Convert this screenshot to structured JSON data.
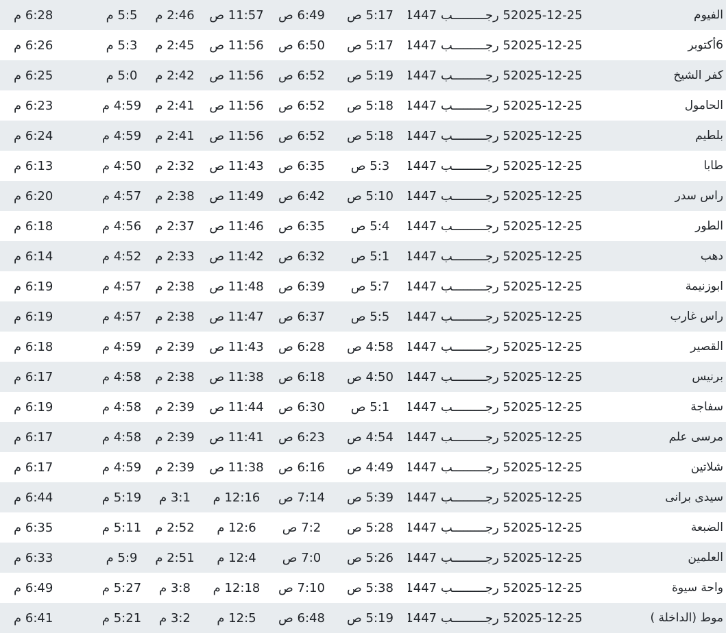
{
  "rows": [
    {
      "city": "الفيوم",
      "date": "2025-12-25",
      "hijri": "5 رجـــــــــب 1447",
      "fajr": "5:17 ص",
      "sunrise": "6:49 ص",
      "dhuhr": "11:57 ص",
      "asr": "2:46 م",
      "maghrib": "5:5 م",
      "isha": "6:28 م"
    },
    {
      "city": "6أكتوبر",
      "date": "2025-12-25",
      "hijri": "5 رجـــــــــب 1447",
      "fajr": "5:17 ص",
      "sunrise": "6:50 ص",
      "dhuhr": "11:56 ص",
      "asr": "2:45 م",
      "maghrib": "5:3 م",
      "isha": "6:26 م"
    },
    {
      "city": "كفر الشيخ",
      "date": "2025-12-25",
      "hijri": "5 رجـــــــــب 1447",
      "fajr": "5:19 ص",
      "sunrise": "6:52 ص",
      "dhuhr": "11:56 ص",
      "asr": "2:42 م",
      "maghrib": "5:0 م",
      "isha": "6:25 م"
    },
    {
      "city": "الحامول",
      "date": "2025-12-25",
      "hijri": "5 رجـــــــــب 1447",
      "fajr": "5:18 ص",
      "sunrise": "6:52 ص",
      "dhuhr": "11:56 ص",
      "asr": "2:41 م",
      "maghrib": "4:59 م",
      "isha": "6:23 م"
    },
    {
      "city": "بلطيم",
      "date": "2025-12-25",
      "hijri": "5 رجـــــــــب 1447",
      "fajr": "5:18 ص",
      "sunrise": "6:52 ص",
      "dhuhr": "11:56 ص",
      "asr": "2:41 م",
      "maghrib": "4:59 م",
      "isha": "6:24 م"
    },
    {
      "city": "طابا",
      "date": "2025-12-25",
      "hijri": "5 رجـــــــــب 1447",
      "fajr": "5:3 ص",
      "sunrise": "6:35 ص",
      "dhuhr": "11:43 ص",
      "asr": "2:32 م",
      "maghrib": "4:50 م",
      "isha": "6:13 م"
    },
    {
      "city": "راس سدر",
      "date": "2025-12-25",
      "hijri": "5 رجـــــــــب 1447",
      "fajr": "5:10 ص",
      "sunrise": "6:42 ص",
      "dhuhr": "11:49 ص",
      "asr": "2:38 م",
      "maghrib": "4:57 م",
      "isha": "6:20 م"
    },
    {
      "city": "الطور",
      "date": "2025-12-25",
      "hijri": "5 رجـــــــــب 1447",
      "fajr": "5:4 ص",
      "sunrise": "6:35 ص",
      "dhuhr": "11:46 ص",
      "asr": "2:37 م",
      "maghrib": "4:56 م",
      "isha": "6:18 م"
    },
    {
      "city": "دهب",
      "date": "2025-12-25",
      "hijri": "5 رجـــــــــب 1447",
      "fajr": "5:1 ص",
      "sunrise": "6:32 ص",
      "dhuhr": "11:42 ص",
      "asr": "2:33 م",
      "maghrib": "4:52 م",
      "isha": "6:14 م"
    },
    {
      "city": "ابوزنيمة",
      "date": "2025-12-25",
      "hijri": "5 رجـــــــــب 1447",
      "fajr": "5:7 ص",
      "sunrise": "6:39 ص",
      "dhuhr": "11:48 ص",
      "asr": "2:38 م",
      "maghrib": "4:57 م",
      "isha": "6:19 م"
    },
    {
      "city": "راس غارب",
      "date": "2025-12-25",
      "hijri": "5 رجـــــــــب 1447",
      "fajr": "5:5 ص",
      "sunrise": "6:37 ص",
      "dhuhr": "11:47 ص",
      "asr": "2:38 م",
      "maghrib": "4:57 م",
      "isha": "6:19 م"
    },
    {
      "city": "القصير",
      "date": "2025-12-25",
      "hijri": "5 رجـــــــــب 1447",
      "fajr": "4:58 ص",
      "sunrise": "6:28 ص",
      "dhuhr": "11:43 ص",
      "asr": "2:39 م",
      "maghrib": "4:59 م",
      "isha": "6:18 م"
    },
    {
      "city": "برنيس",
      "date": "2025-12-25",
      "hijri": "5 رجـــــــــب 1447",
      "fajr": "4:50 ص",
      "sunrise": "6:18 ص",
      "dhuhr": "11:38 ص",
      "asr": "2:38 م",
      "maghrib": "4:58 م",
      "isha": "6:17 م"
    },
    {
      "city": "سفاجة",
      "date": "2025-12-25",
      "hijri": "5 رجـــــــــب 1447",
      "fajr": "5:1 ص",
      "sunrise": "6:30 ص",
      "dhuhr": "11:44 ص",
      "asr": "2:39 م",
      "maghrib": "4:58 م",
      "isha": "6:19 م"
    },
    {
      "city": "مرسى علم",
      "date": "2025-12-25",
      "hijri": "5 رجـــــــــب 1447",
      "fajr": "4:54 ص",
      "sunrise": "6:23 ص",
      "dhuhr": "11:41 ص",
      "asr": "2:39 م",
      "maghrib": "4:58 م",
      "isha": "6:17 م"
    },
    {
      "city": "شلاتين",
      "date": "2025-12-25",
      "hijri": "5 رجـــــــــب 1447",
      "fajr": "4:49 ص",
      "sunrise": "6:16 ص",
      "dhuhr": "11:38 ص",
      "asr": "2:39 م",
      "maghrib": "4:59 م",
      "isha": "6:17 م"
    },
    {
      "city": "سيدى برانى",
      "date": "2025-12-25",
      "hijri": "5 رجـــــــــب 1447",
      "fajr": "5:39 ص",
      "sunrise": "7:14 ص",
      "dhuhr": "12:16 م",
      "asr": "3:1 م",
      "maghrib": "5:19 م",
      "isha": "6:44 م"
    },
    {
      "city": "الضبعة",
      "date": "2025-12-25",
      "hijri": "5 رجـــــــــب 1447",
      "fajr": "5:28 ص",
      "sunrise": "7:2 ص",
      "dhuhr": "12:6 م",
      "asr": "2:52 م",
      "maghrib": "5:11 م",
      "isha": "6:35 م"
    },
    {
      "city": "العلمين",
      "date": "2025-12-25",
      "hijri": "5 رجـــــــــب 1447",
      "fajr": "5:26 ص",
      "sunrise": "7:0 ص",
      "dhuhr": "12:4 م",
      "asr": "2:51 م",
      "maghrib": "5:9 م",
      "isha": "6:33 م"
    },
    {
      "city": "واحة سيوة",
      "date": "2025-12-25",
      "hijri": "5 رجـــــــــب 1447",
      "fajr": "5:38 ص",
      "sunrise": "7:10 ص",
      "dhuhr": "12:18 م",
      "asr": "3:8 م",
      "maghrib": "5:27 م",
      "isha": "6:49 م"
    },
    {
      "city": "موط (الداخلة )",
      "date": "2025-12-25",
      "hijri": "5 رجـــــــــب 1447",
      "fajr": "5:19 ص",
      "sunrise": "6:48 ص",
      "dhuhr": "12:5 م",
      "asr": "3:2 م",
      "maghrib": "5:21 م",
      "isha": "6:41 م"
    }
  ]
}
